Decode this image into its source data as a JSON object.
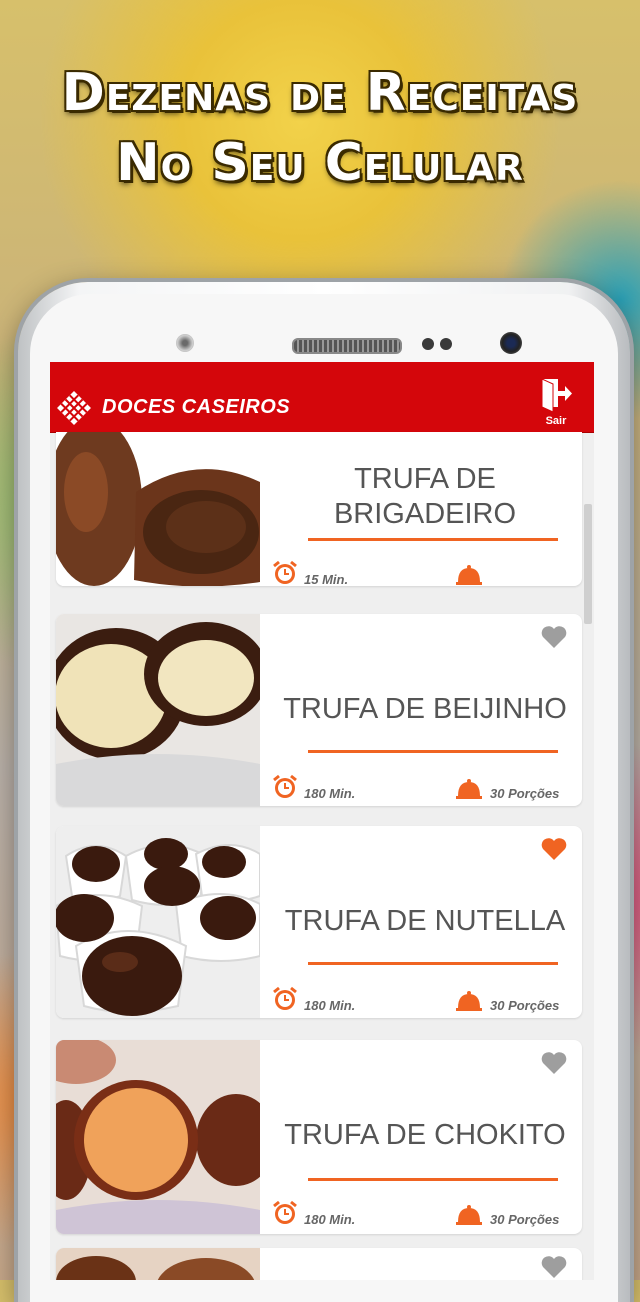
{
  "promo": {
    "line1": "Dezenas de Receitas",
    "line2": "No Seu Celular"
  },
  "app": {
    "title": "DOCES CASEIROS",
    "exit_label": "Sair",
    "accent": "#d4060b",
    "rule_color": "#f06422"
  },
  "recipes": [
    {
      "title_line1": "TRUFA DE",
      "title_line2": "BRIGADEIRO",
      "time": "15 Min.",
      "portions": "",
      "favorite": null
    },
    {
      "title_line1": "TRUFA DE BEIJINHO",
      "title_line2": "",
      "time": "180 Min.",
      "portions": "30 Porções",
      "favorite": false
    },
    {
      "title_line1": "TRUFA DE NUTELLA",
      "title_line2": "",
      "time": "180 Min.",
      "portions": "30 Porções",
      "favorite": true
    },
    {
      "title_line1": "TRUFA DE CHOKITO",
      "title_line2": "",
      "time": "180 Min.",
      "portions": "30 Porções",
      "favorite": false
    }
  ]
}
